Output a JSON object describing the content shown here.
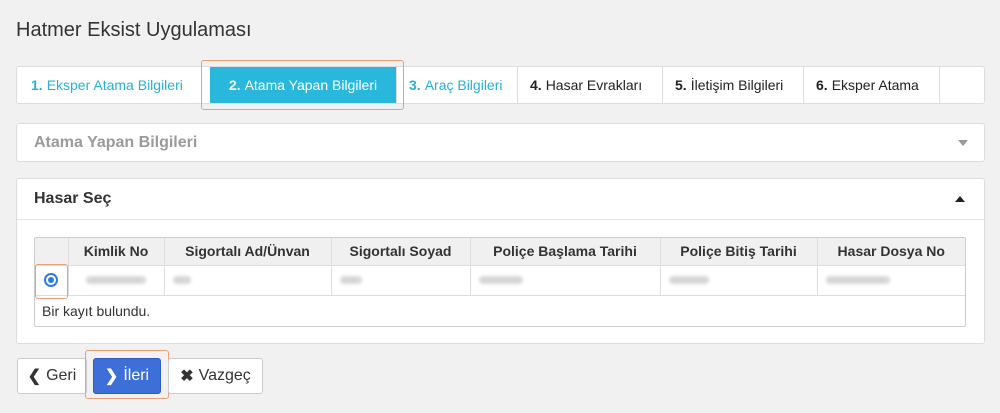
{
  "app": {
    "title": "Hatmer Eksist Uygulaması"
  },
  "wizard": {
    "steps": [
      {
        "num": "1.",
        "label": "Eksper Atama Bilgileri",
        "state": "done"
      },
      {
        "num": "2.",
        "label": "Atama Yapan Bilgileri",
        "state": "active"
      },
      {
        "num": "3.",
        "label": "Araç Bilgileri",
        "state": "done"
      },
      {
        "num": "4.",
        "label": "Hasar Evrakları",
        "state": "todo"
      },
      {
        "num": "5.",
        "label": "İletişim Bilgileri",
        "state": "todo"
      },
      {
        "num": "6.",
        "label": "Eksper Atama",
        "state": "todo"
      }
    ]
  },
  "panel_atama": {
    "title": "Atama Yapan Bilgileri",
    "collapsed": true,
    "icon": "caret-down-icon"
  },
  "panel_hasar": {
    "title": "Hasar Seç",
    "icon": "caret-up-icon",
    "columns": [
      "Kimlik No",
      "Sigortalı Ad/Ünvan",
      "Sigortalı Soyad",
      "Poliçe Başlama Tarihi",
      "Poliçe Bitiş Tarihi",
      "Hasar Dosya No"
    ],
    "rows": [
      {
        "selected": true,
        "cells": [
          "",
          "",
          "",
          "",
          "",
          ""
        ]
      }
    ],
    "footer": "Bir kayıt bulundu."
  },
  "buttons": {
    "back_label": "Geri",
    "next_label": "İleri",
    "cancel_label": "Vazgeç"
  },
  "colors": {
    "accent": "#29b7dc",
    "primary": "#3e6fd8",
    "highlight": "#e9a07a"
  }
}
